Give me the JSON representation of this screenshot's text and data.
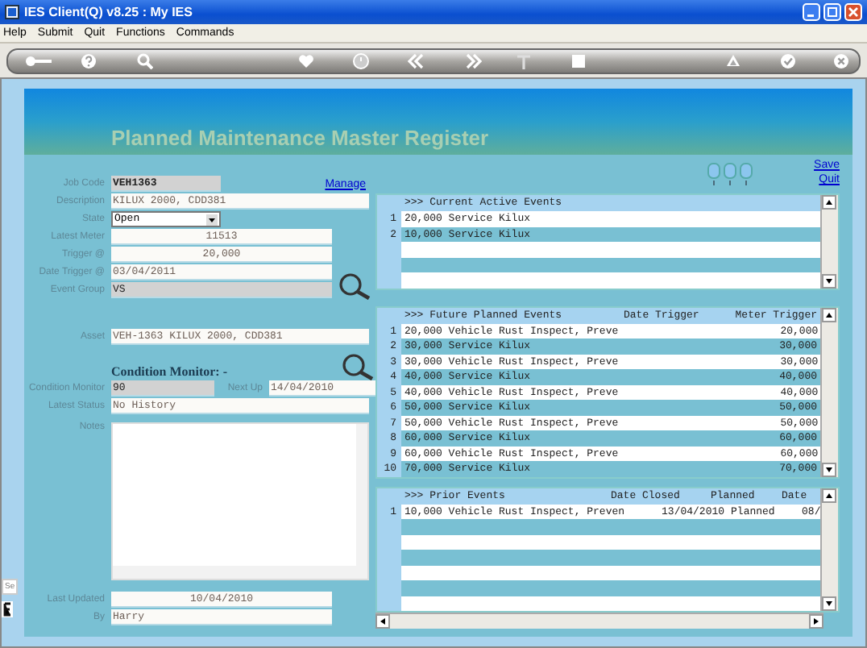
{
  "window": {
    "title": "IES Client(Q) v8.25 : My IES"
  },
  "menu": [
    "Help",
    "Submit",
    "Quit",
    "Functions",
    "Commands"
  ],
  "page_title": "Planned Maintenance Master Register",
  "links": {
    "manage": "Manage",
    "save": "Save",
    "quit": "Quit"
  },
  "form": {
    "fields": [
      {
        "label": "Job Code",
        "value": "VEH1363",
        "kind": "code"
      },
      {
        "label": "Description",
        "value": "KILUX 2000, CDD381",
        "kind": "text"
      },
      {
        "label": "State",
        "value": "Open",
        "kind": "select"
      },
      {
        "label": "Latest Meter",
        "value": "11513",
        "kind": "meter"
      },
      {
        "label": "Trigger @",
        "value": "20,000",
        "kind": "meter"
      },
      {
        "label": "Date Trigger @",
        "value": "03/04/2011",
        "kind": "date"
      },
      {
        "label": "Event Group",
        "value": "VS",
        "kind": "group"
      },
      {
        "label": "Asset",
        "value": "VEH-1363 KILUX 2000, CDD381",
        "kind": "text"
      }
    ],
    "condition_heading": "Condition Monitor: -",
    "condition": {
      "label": "Condition Monitor",
      "value": "90",
      "next_label": "Next Up",
      "next_value": "14/04/2010"
    },
    "status": {
      "label": "Latest Status",
      "value": "No History"
    },
    "notes_label": "Notes",
    "updated": {
      "label": "Last Updated",
      "value": "10/04/2010"
    },
    "by": {
      "label": "By",
      "value": "Harry"
    }
  },
  "grids": [
    {
      "columns": [
        {
          "label": ">>> Current Active Events",
          "kind": "text"
        }
      ],
      "rows": [
        {
          "number": "1",
          "cells": [
            "20,000 Service Kilux"
          ]
        },
        {
          "number": "2",
          "cells": [
            "10,000 Service Kilux"
          ]
        }
      ]
    },
    {
      "columns": [
        {
          "label": ">>> Future Planned Events",
          "kind": "text"
        },
        {
          "label": "Date Trigger",
          "kind": "date"
        },
        {
          "label": "Meter Trigger",
          "kind": "number"
        }
      ],
      "rows": [
        {
          "number": "1",
          "cells": [
            "20,000 Vehicle Rust Inspect, Preve",
            null,
            "20,000"
          ]
        },
        {
          "number": "2",
          "cells": [
            "30,000 Service Kilux",
            null,
            "30,000"
          ]
        },
        {
          "number": "3",
          "cells": [
            "30,000 Vehicle Rust Inspect, Preve",
            null,
            "30,000"
          ]
        },
        {
          "number": "4",
          "cells": [
            "40,000 Service Kilux",
            null,
            "40,000"
          ]
        },
        {
          "number": "5",
          "cells": [
            "40,000 Vehicle Rust Inspect, Preve",
            null,
            "40,000"
          ]
        },
        {
          "number": "6",
          "cells": [
            "50,000 Service Kilux",
            null,
            "50,000"
          ]
        },
        {
          "number": "7",
          "cells": [
            "50,000 Vehicle Rust Inspect, Preve",
            null,
            "50,000"
          ]
        },
        {
          "number": "8",
          "cells": [
            "60,000 Service Kilux",
            null,
            "60,000"
          ]
        },
        {
          "number": "9",
          "cells": [
            "60,000 Vehicle Rust Inspect, Preve",
            null,
            "60,000"
          ]
        },
        {
          "number": "10",
          "cells": [
            "70,000 Service Kilux",
            null,
            "70,000"
          ]
        }
      ]
    },
    {
      "columns": [
        {
          "label": ">>> Prior Events",
          "kind": "text"
        },
        {
          "label": "Date Closed",
          "kind": "date"
        },
        {
          "label": "Planned",
          "kind": "status"
        },
        {
          "label": "Date",
          "kind": "cut"
        }
      ],
      "rows": [
        {
          "number": "1",
          "cells": [
            "10,000 Vehicle Rust Inspect, Preven",
            "13/04/2010",
            "Planned",
            "08/"
          ]
        }
      ]
    }
  ],
  "side_tab": "Se"
}
